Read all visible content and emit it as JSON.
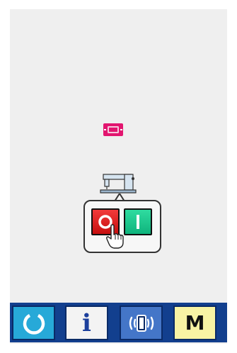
{
  "screen": {
    "status_icon": "memory-card-icon",
    "machine_icon": "sewing-machine-icon",
    "callout": {
      "off_button_icon": "power-off-icon",
      "on_button_icon": "power-on-icon",
      "hand_icon": "pointing-hand-icon"
    }
  },
  "toolbar": {
    "reset_icon": "reset-icon",
    "info_label": "i",
    "comm_icon": "communication-icon",
    "mode_label": "M"
  },
  "colors": {
    "screen_bg": "#efefef",
    "status_icon": "#e2156f",
    "off_button": "#e11f1f",
    "on_button": "#14c48a",
    "toolbar_bg": "#123f8e",
    "reset_button": "#27a9d8",
    "comm_button": "#4476c8",
    "mode_button": "#f8f3a4"
  }
}
